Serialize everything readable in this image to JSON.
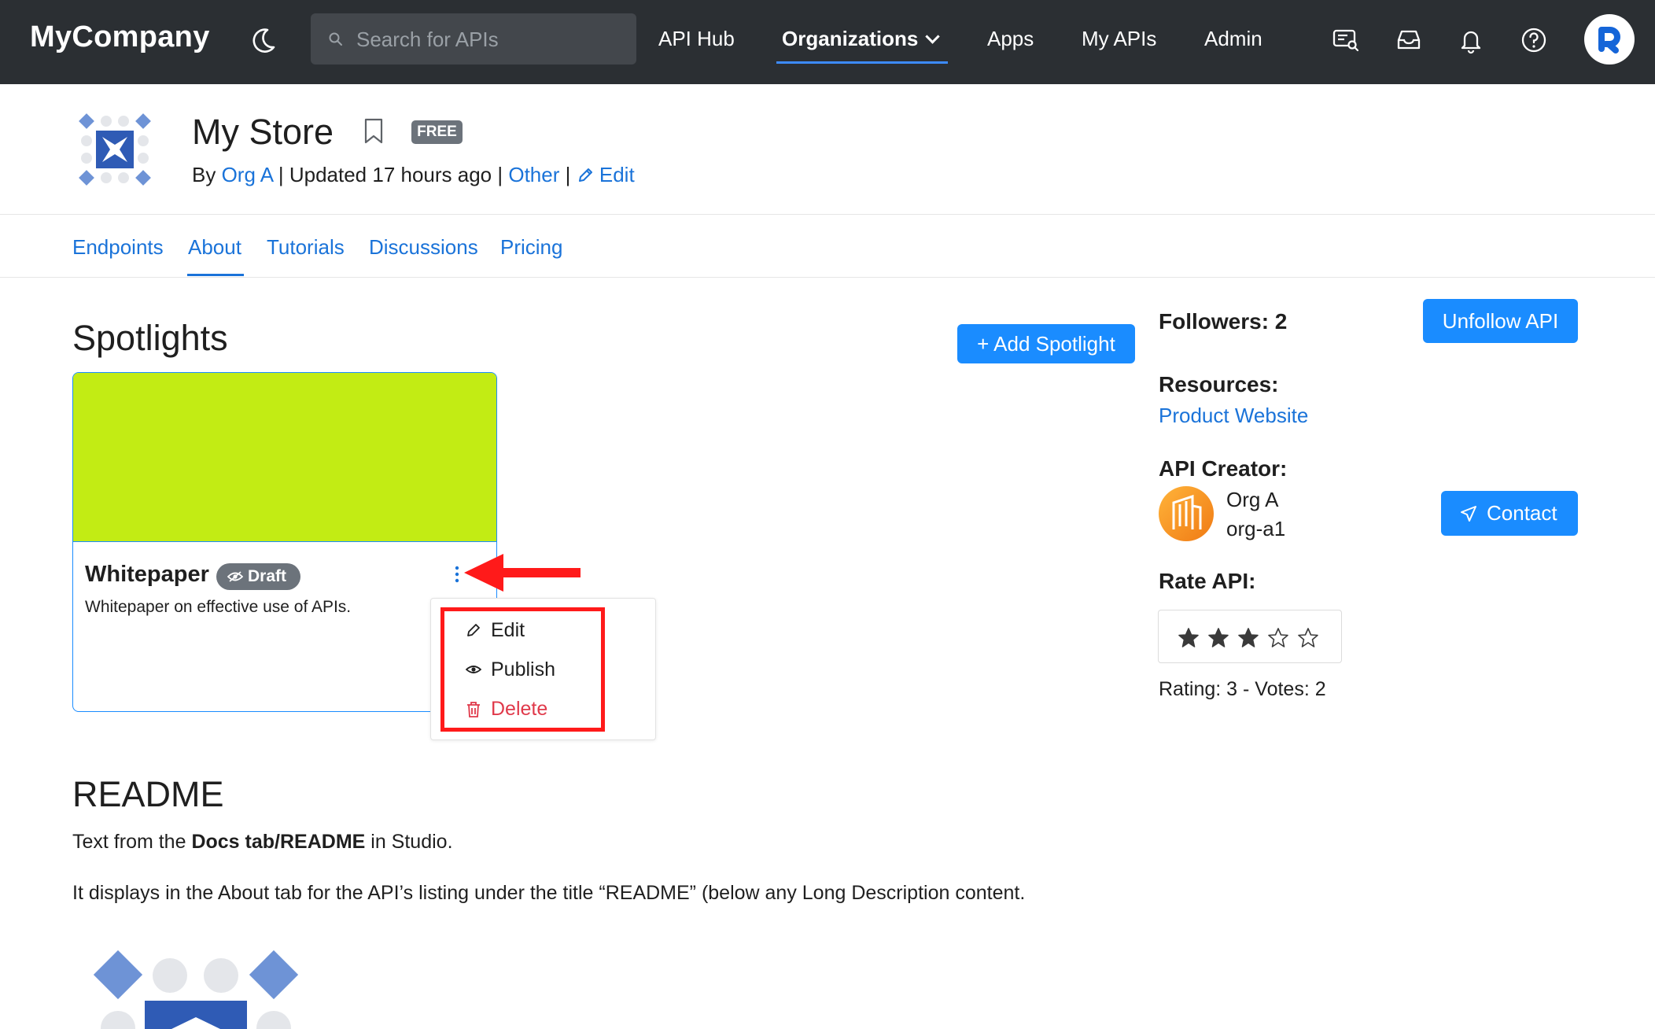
{
  "nav": {
    "brand": "MyCompany",
    "search_placeholder": "Search for APIs",
    "links": [
      "API Hub",
      "Organizations",
      "Apps",
      "My APIs",
      "Admin"
    ]
  },
  "api": {
    "title": "My Store",
    "badge": "FREE",
    "by_label": "By",
    "org": "Org A",
    "updated": "| Updated 17 hours ago |",
    "category": "Other",
    "sep": "|",
    "edit_label": "Edit"
  },
  "tabs": [
    "Endpoints",
    "About",
    "Tutorials",
    "Discussions",
    "Pricing"
  ],
  "spotlights": {
    "heading": "Spotlights",
    "add_button": "+ Add Spotlight",
    "card": {
      "title": "Whitepaper",
      "status": "Draft",
      "description": "Whitepaper on effective use of APIs."
    },
    "menu": [
      "Edit",
      "Publish",
      "Delete"
    ]
  },
  "sidebar": {
    "followers": "Followers: 2",
    "unfollow_button": "Unfollow API",
    "resources_label": "Resources:",
    "resource_link": "Product Website",
    "creator_label": "API Creator:",
    "creator_name": "Org A",
    "creator_id": "org-a1",
    "contact_button": "Contact",
    "rate_label": "Rate API:",
    "rating": {
      "value": 3,
      "max": 5
    },
    "rating_summary": "Rating: 3 - Votes: 2"
  },
  "readme": {
    "heading": "README",
    "p1_before": "Text from the ",
    "p1_bold": "Docs tab/README",
    "p1_after": " in Studio.",
    "p2": "It displays in the About tab for the API’s listing under the title “README” (below any Long Description content."
  },
  "colors": {
    "nav_bg": "#2b2f33",
    "accent": "#1a8cff",
    "link": "#1a73d9",
    "banner": "#c2ec14",
    "danger": "#e0394a",
    "highlight": "#ff1a1a"
  }
}
